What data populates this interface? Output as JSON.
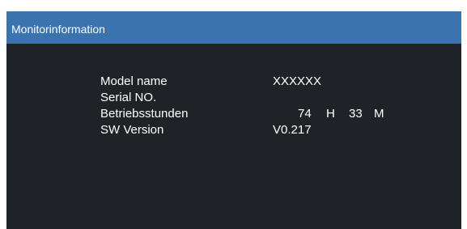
{
  "window": {
    "title": "Monitorinformation"
  },
  "info": {
    "model_name_label": "Model name",
    "model_name_value": "XXXXXX",
    "serial_label": "Serial NO.",
    "serial_value": "",
    "hours_label": "Betriebsstunden",
    "hours_value": "74",
    "hours_unit": "H",
    "minutes_value": "33",
    "minutes_unit": "M",
    "sw_label": "SW Version",
    "sw_value": "V0.217"
  },
  "colors": {
    "title_bar": "#3a73ad",
    "background": "#1f2328",
    "text": "#ffffff"
  }
}
